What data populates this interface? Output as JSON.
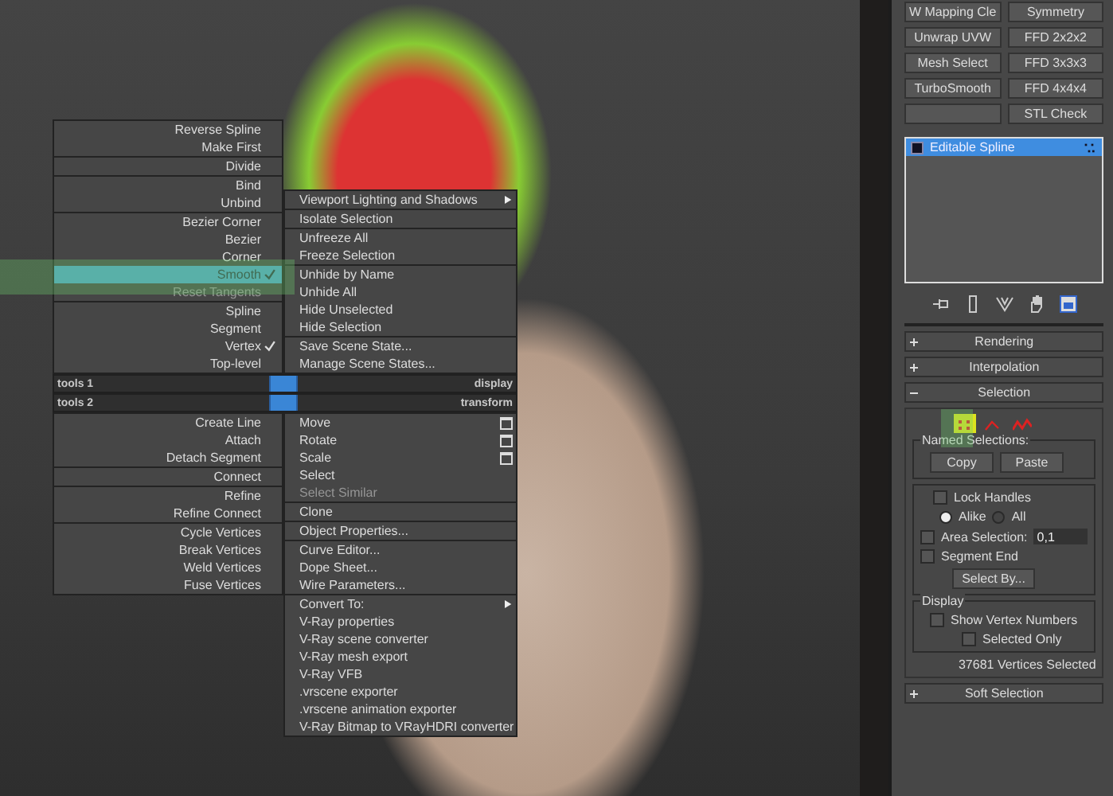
{
  "quad_menu": {
    "top_left": [
      {
        "items": [
          {
            "label": "Reverse Spline",
            "kind": "plain",
            "checked": false,
            "selected": false,
            "disabled": false
          },
          {
            "label": "Make First",
            "kind": "plain",
            "checked": false,
            "selected": false,
            "disabled": false
          }
        ]
      },
      {
        "items": [
          {
            "label": "Divide",
            "kind": "plain",
            "checked": false,
            "selected": false,
            "disabled": false
          }
        ]
      },
      {
        "items": [
          {
            "label": "Bind",
            "kind": "plain",
            "checked": false,
            "selected": false,
            "disabled": false
          },
          {
            "label": "Unbind",
            "kind": "plain",
            "checked": false,
            "selected": false,
            "disabled": false
          }
        ]
      },
      {
        "items": [
          {
            "label": "Bezier Corner",
            "kind": "plain",
            "checked": false,
            "selected": false,
            "disabled": false
          },
          {
            "label": "Bezier",
            "kind": "plain",
            "checked": false,
            "selected": false,
            "disabled": false
          },
          {
            "label": "Corner",
            "kind": "plain",
            "checked": false,
            "selected": false,
            "disabled": false
          },
          {
            "label": "Smooth",
            "kind": "plain",
            "checked": true,
            "selected": true,
            "disabled": false
          },
          {
            "label": "Reset Tangents",
            "kind": "plain",
            "checked": false,
            "selected": false,
            "disabled": true
          }
        ]
      },
      {
        "items": [
          {
            "label": "Spline",
            "kind": "plain",
            "checked": false,
            "selected": false,
            "disabled": false
          },
          {
            "label": "Segment",
            "kind": "plain",
            "checked": false,
            "selected": false,
            "disabled": false
          },
          {
            "label": "Vertex",
            "kind": "plain",
            "checked": true,
            "selected": false,
            "disabled": false
          },
          {
            "label": "Top-level",
            "kind": "plain",
            "checked": false,
            "selected": false,
            "disabled": false
          }
        ]
      }
    ],
    "top_right": [
      {
        "items": [
          {
            "label": "Viewport Lighting and Shadows",
            "kind": "submenu",
            "checked": false,
            "selected": false,
            "disabled": false
          }
        ]
      },
      {
        "items": [
          {
            "label": "Isolate Selection",
            "kind": "plain",
            "checked": false,
            "selected": false,
            "disabled": false
          }
        ]
      },
      {
        "items": [
          {
            "label": "Unfreeze All",
            "kind": "plain",
            "checked": false,
            "selected": false,
            "disabled": false
          },
          {
            "label": "Freeze Selection",
            "kind": "plain",
            "checked": false,
            "selected": false,
            "disabled": false
          }
        ]
      },
      {
        "items": [
          {
            "label": "Unhide by Name",
            "kind": "plain",
            "checked": false,
            "selected": false,
            "disabled": false
          },
          {
            "label": "Unhide All",
            "kind": "plain",
            "checked": false,
            "selected": false,
            "disabled": false
          },
          {
            "label": "Hide Unselected",
            "kind": "plain",
            "checked": false,
            "selected": false,
            "disabled": false
          },
          {
            "label": "Hide Selection",
            "kind": "plain",
            "checked": false,
            "selected": false,
            "disabled": false
          }
        ]
      },
      {
        "items": [
          {
            "label": "Save Scene State...",
            "kind": "plain",
            "checked": false,
            "selected": false,
            "disabled": false
          },
          {
            "label": "Manage Scene States...",
            "kind": "plain",
            "checked": false,
            "selected": false,
            "disabled": false
          }
        ]
      }
    ],
    "bars": [
      {
        "left": "tools 1",
        "right": "display"
      },
      {
        "left": "tools 2",
        "right": "transform"
      }
    ],
    "bottom_left": [
      {
        "items": [
          {
            "label": "Create Line",
            "kind": "plain",
            "checked": false,
            "selected": false,
            "disabled": false
          },
          {
            "label": "Attach",
            "kind": "plain",
            "checked": false,
            "selected": false,
            "disabled": false
          },
          {
            "label": "Detach Segment",
            "kind": "plain",
            "checked": false,
            "selected": false,
            "disabled": false
          }
        ]
      },
      {
        "items": [
          {
            "label": "Connect",
            "kind": "plain",
            "checked": false,
            "selected": false,
            "disabled": false
          }
        ]
      },
      {
        "items": [
          {
            "label": "Refine",
            "kind": "plain",
            "checked": false,
            "selected": false,
            "disabled": false
          },
          {
            "label": "Refine Connect",
            "kind": "plain",
            "checked": false,
            "selected": false,
            "disabled": false
          }
        ]
      },
      {
        "items": [
          {
            "label": "Cycle Vertices",
            "kind": "plain",
            "checked": false,
            "selected": false,
            "disabled": false
          },
          {
            "label": "Break Vertices",
            "kind": "plain",
            "checked": false,
            "selected": false,
            "disabled": false
          },
          {
            "label": "Weld Vertices",
            "kind": "plain",
            "checked": false,
            "selected": false,
            "disabled": false
          },
          {
            "label": "Fuse Vertices",
            "kind": "plain",
            "checked": false,
            "selected": false,
            "disabled": false
          }
        ]
      }
    ],
    "bottom_right": [
      {
        "items": [
          {
            "label": "Move",
            "kind": "option",
            "checked": false,
            "selected": false,
            "disabled": false
          },
          {
            "label": "Rotate",
            "kind": "option",
            "checked": false,
            "selected": false,
            "disabled": false
          },
          {
            "label": "Scale",
            "kind": "option",
            "checked": false,
            "selected": false,
            "disabled": false
          },
          {
            "label": "Select",
            "kind": "plain",
            "checked": false,
            "selected": false,
            "disabled": false
          },
          {
            "label": "Select Similar",
            "kind": "plain",
            "checked": false,
            "selected": false,
            "disabled": true
          }
        ]
      },
      {
        "items": [
          {
            "label": "Clone",
            "kind": "plain",
            "checked": false,
            "selected": false,
            "disabled": false
          }
        ]
      },
      {
        "items": [
          {
            "label": "Object Properties...",
            "kind": "plain",
            "checked": false,
            "selected": false,
            "disabled": false
          }
        ]
      },
      {
        "items": [
          {
            "label": "Curve Editor...",
            "kind": "plain",
            "checked": false,
            "selected": false,
            "disabled": false
          },
          {
            "label": "Dope Sheet...",
            "kind": "plain",
            "checked": false,
            "selected": false,
            "disabled": false
          },
          {
            "label": "Wire Parameters...",
            "kind": "plain",
            "checked": false,
            "selected": false,
            "disabled": false
          }
        ]
      },
      {
        "items": [
          {
            "label": "Convert To:",
            "kind": "submenu",
            "checked": false,
            "selected": false,
            "disabled": false
          },
          {
            "label": "V-Ray properties",
            "kind": "plain",
            "checked": false,
            "selected": false,
            "disabled": false
          },
          {
            "label": "V-Ray scene converter",
            "kind": "plain",
            "checked": false,
            "selected": false,
            "disabled": false
          },
          {
            "label": "V-Ray mesh export",
            "kind": "plain",
            "checked": false,
            "selected": false,
            "disabled": false
          },
          {
            "label": "V-Ray VFB",
            "kind": "plain",
            "checked": false,
            "selected": false,
            "disabled": false
          },
          {
            "label": ".vrscene exporter",
            "kind": "plain",
            "checked": false,
            "selected": false,
            "disabled": false
          },
          {
            "label": ".vrscene animation exporter",
            "kind": "plain",
            "checked": false,
            "selected": false,
            "disabled": false
          },
          {
            "label": "V-Ray Bitmap to VRayHDRI converter",
            "kind": "plain",
            "checked": false,
            "selected": false,
            "disabled": false
          }
        ]
      }
    ]
  },
  "command_panel": {
    "modifier_buttons": [
      {
        "kind": "text",
        "label": "W Mapping Cle"
      },
      {
        "kind": "text",
        "label": "Symmetry"
      },
      {
        "kind": "text",
        "label": "Unwrap UVW"
      },
      {
        "kind": "text",
        "label": "FFD 2x2x2"
      },
      {
        "kind": "text",
        "label": "Mesh Select"
      },
      {
        "kind": "text",
        "label": "FFD 3x3x3"
      },
      {
        "kind": "text",
        "label": "TurboSmooth"
      },
      {
        "kind": "text",
        "label": "FFD 4x4x4"
      },
      {
        "kind": "blank"
      },
      {
        "kind": "text",
        "label": "STL Check"
      }
    ],
    "modifier_stack": [
      {
        "label": "Editable Spline",
        "selected": true
      }
    ],
    "rollouts": [
      {
        "label": "Rendering",
        "expanded": false
      },
      {
        "label": "Interpolation",
        "expanded": false
      },
      {
        "label": "Selection",
        "expanded": true
      }
    ],
    "selection": {
      "levels": [
        {
          "kind": "vertex",
          "selected": true
        },
        {
          "kind": "segment",
          "selected": false
        },
        {
          "kind": "spline",
          "selected": false
        }
      ],
      "named_selections": {
        "title": "Named Selections:",
        "buttons": [
          "Copy",
          "Paste"
        ]
      },
      "lock_handles": {
        "label": "Lock Handles",
        "checked": false
      },
      "radios": [
        {
          "label": "Alike",
          "selected": true
        },
        {
          "label": "All",
          "selected": false
        }
      ],
      "area_selection": {
        "label": "Area Selection:",
        "checked": false,
        "value": "0,1"
      },
      "segment_end": {
        "label": "Segment End",
        "checked": false
      },
      "select_by": "Select By...",
      "display": {
        "title": "Display",
        "checkboxes": [
          {
            "label": "Show Vertex Numbers",
            "checked": false
          },
          {
            "label": "Selected Only",
            "checked": false
          }
        ]
      },
      "status": "37681 Vertices Selected"
    },
    "soft_selection": {
      "label": "Soft Selection",
      "expanded": false
    }
  }
}
